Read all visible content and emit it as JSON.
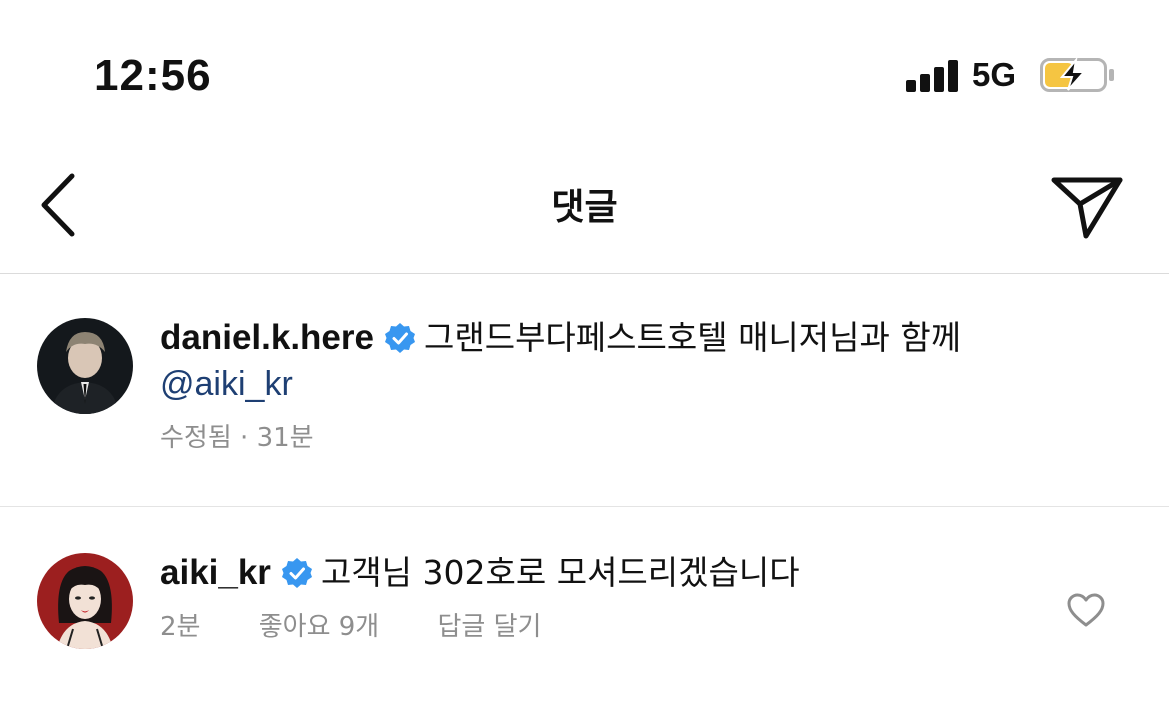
{
  "status_bar": {
    "time": "12:56",
    "network": "5G",
    "signal_icon": "signal-bars-icon",
    "battery_icon": "battery-charging-icon",
    "battery_color": "#f5c542"
  },
  "header": {
    "title": "댓글",
    "back_icon": "chevron-left-icon",
    "share_icon": "paper-plane-icon"
  },
  "comments": [
    {
      "username": "daniel.k.here",
      "verified": true,
      "text": "그랜드부다페스트호텔 매니저님과 함께",
      "mention": "@aiki_kr",
      "edited_label": "수정됨",
      "separator": "·",
      "time": "31분"
    },
    {
      "username": "aiki_kr",
      "verified": true,
      "text": "고객님 302호로 모셔드리겠습니다",
      "time": "2분",
      "likes_label": "좋아요 9개",
      "reply_label": "답글 달기",
      "like_icon": "heart-outline-icon"
    }
  ],
  "colors": {
    "verified_blue": "#3897f0",
    "mention": "#1e3f73",
    "meta_gray": "#8e8e8e",
    "divider": "#dbdbdb"
  }
}
